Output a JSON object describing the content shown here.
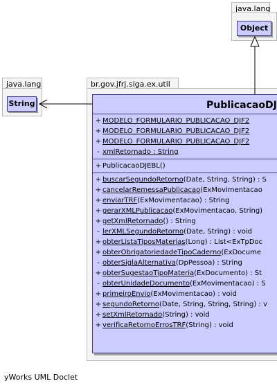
{
  "packages": {
    "object_pkg": {
      "name": "java.lang"
    },
    "string_pkg": {
      "name": "java.lang"
    },
    "util_pkg": {
      "name": "br.gov.jfrj.siga.ex.util"
    }
  },
  "classes": {
    "object": {
      "name": "Object"
    },
    "string": {
      "name": "String"
    },
    "main": {
      "name": "PublicacaoDJ"
    }
  },
  "fields": [
    {
      "vis": "+",
      "text": "MODELO_FORMULARIO_PUBLICACAO_DJF2",
      "static": true
    },
    {
      "vis": "+",
      "text": "MODELO_FORMULARIO_PUBLICACAO_DJF2",
      "static": true
    },
    {
      "vis": "+",
      "text": "MODELO_FORMULARIO_PUBLICACAO_DJF2",
      "static": true
    },
    {
      "vis": "-",
      "text": "xmlRetornado : String",
      "static": false
    }
  ],
  "constructors": [
    {
      "vis": "+",
      "text": "PublicacaoDJEBL()"
    }
  ],
  "methods": [
    {
      "vis": "+",
      "name": "buscarSegundoRetorno",
      "rest": "(Date, String, String) : S"
    },
    {
      "vis": "+",
      "name": "cancelarRemessaPublicacao",
      "rest": "(ExMovimentacao"
    },
    {
      "vis": "+",
      "name": "enviarTRF",
      "rest": "(ExMovimentacao) : String"
    },
    {
      "vis": "+",
      "name": "gerarXMLPublicacao",
      "rest": "(ExMovimentacao, String)"
    },
    {
      "vis": "+",
      "name": "getXmlRetornado",
      "rest": "() : String"
    },
    {
      "vis": "-",
      "name": "lerXMLSegundoRetorno",
      "rest": "(Date, String) : void"
    },
    {
      "vis": "+",
      "name": "obterListaTiposMaterias",
      "rest": "(Long) : List<ExTpDoc"
    },
    {
      "vis": "+",
      "name": "obterObrigatoriedadeTipoCaderno",
      "rest": "(ExDocume"
    },
    {
      "vis": "-",
      "name": "obterSiglaAlternativa",
      "rest": "(DpPessoa) : String"
    },
    {
      "vis": "+",
      "name": "obterSugestaoTipoMateria",
      "rest": "(ExDocumento) : St"
    },
    {
      "vis": "-",
      "name": "obterUnidadeDocumento",
      "rest": "(ExMovimentacao) : S"
    },
    {
      "vis": "+",
      "name": "primeiroEnvio",
      "rest": "(ExMovimentacao) : void"
    },
    {
      "vis": "+",
      "name": "segundoRetorno",
      "rest": "(Date, String, String, String) : v"
    },
    {
      "vis": "+",
      "name": "setXmlRetornado",
      "rest": "(String) : void"
    },
    {
      "vis": "+",
      "name": "verificaRetornoErrosTRF",
      "rest": "(String) : void"
    }
  ],
  "footer": {
    "text": "yWorks UML Doclet"
  }
}
